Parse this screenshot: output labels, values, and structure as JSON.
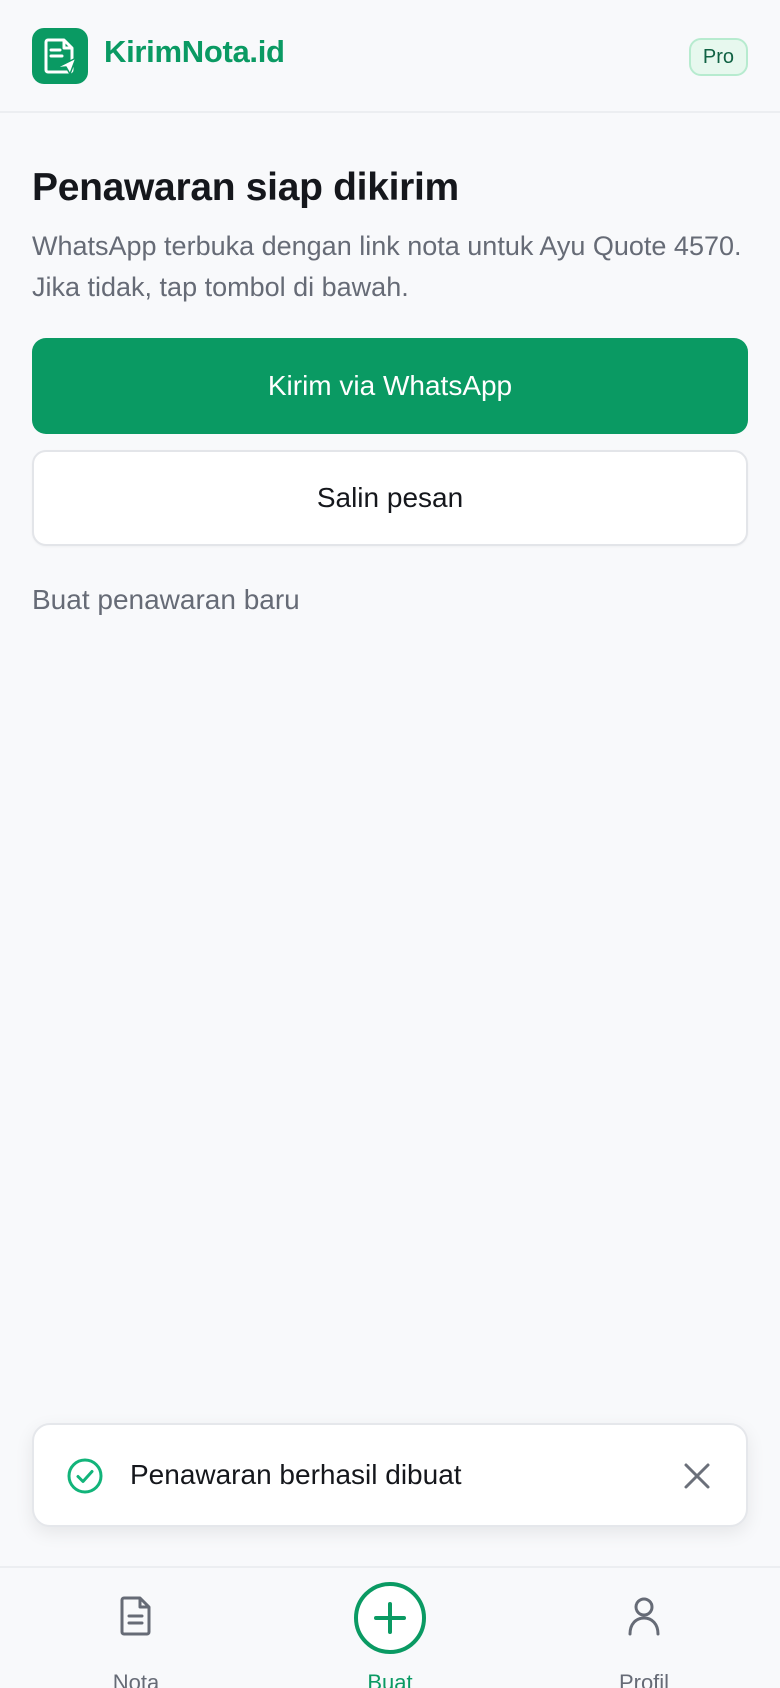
{
  "header": {
    "brand": "KirimNota.id",
    "badge": "Pro",
    "logo_icon": "document-paper-plane-icon"
  },
  "main": {
    "title": "Penawaran siap dikirim",
    "subtitle": "WhatsApp terbuka dengan link nota untuk Ayu Quote 4570. Jika tidak, tap tombol di bawah.",
    "primary_button": "Kirim via WhatsApp",
    "secondary_button": "Salin pesan",
    "new_link": "Buat penawaran baru"
  },
  "toast": {
    "message": "Penawaran berhasil dibuat",
    "icon": "check-circle-icon",
    "close_icon": "close-icon"
  },
  "nav": {
    "items": [
      {
        "label": "Nota",
        "icon": "document-icon",
        "active": false
      },
      {
        "label": "Buat",
        "icon": "plus-circle-icon",
        "active": true
      },
      {
        "label": "Profil",
        "icon": "user-icon",
        "active": false
      }
    ]
  },
  "colors": {
    "accent": "#0a9a63",
    "muted_text": "#666b76",
    "background": "#f8f9fb"
  }
}
